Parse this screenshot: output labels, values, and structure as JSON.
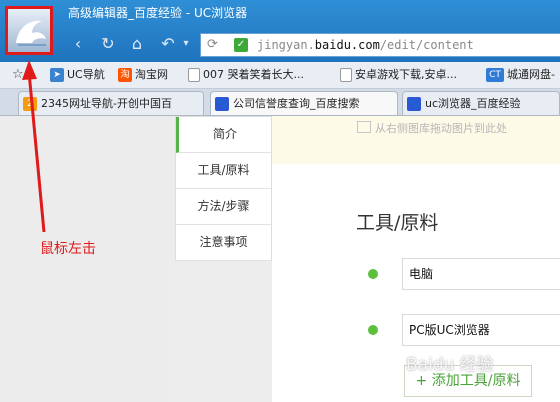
{
  "window": {
    "title": "高级编辑器_百度经验 - UC浏览器"
  },
  "nav": {
    "back": "‹",
    "forward": "↻",
    "home": "⌂",
    "undo": "↶",
    "menu": "▾"
  },
  "address": {
    "host_prefix": "jingyan.",
    "host_main": "baidu",
    "host_suffix": ".com",
    "path": "/edit/content"
  },
  "bookmarks": [
    {
      "label": "UC导航",
      "icon": "uc-nav-icon",
      "color": "#3a82d0"
    },
    {
      "label": "淘宝网",
      "icon": "taobao-icon",
      "color": "#ff5500",
      "glyph": "淘"
    },
    {
      "label": "007 哭着笑着长大...",
      "icon": "page-icon",
      "color": "#ffffff"
    },
    {
      "label": "安卓游戏下载,安卓...",
      "icon": "page-icon",
      "color": "#ffffff"
    },
    {
      "label": "城通网盘-",
      "icon": "ct-icon",
      "color": "#2f7bd6",
      "glyph": "CT"
    }
  ],
  "tabs": [
    {
      "label": "2345网址导航-开创中国百",
      "icon": "2345-icon",
      "color": "#f39c12"
    },
    {
      "label": "公司信誉度查询_百度搜索",
      "icon": "baidu-paw-icon",
      "color": "#2b57d6"
    },
    {
      "label": "uc浏览器_百度经验",
      "icon": "baidu-paw-icon",
      "color": "#2b57d6"
    }
  ],
  "side_menu": [
    {
      "label": "简介",
      "active": true
    },
    {
      "label": "工具/原料",
      "active": false
    },
    {
      "label": "方法/步骤",
      "active": false
    },
    {
      "label": "注意事项",
      "active": false
    }
  ],
  "notice": {
    "text": "从右侧图库拖动图片到此处"
  },
  "content": {
    "section_title": "工具/原料",
    "items": [
      "电脑",
      "PC版UC浏览器"
    ],
    "add_button": "+ 添加工具/原料"
  },
  "annotation": {
    "label": "鼠标左击",
    "color": "#e0191a"
  },
  "watermark": "Baidu 经验",
  "colors": {
    "accent_green": "#5dbf3b",
    "chrome_blue": "#1f73bd",
    "annotation_red": "#e0191a"
  }
}
